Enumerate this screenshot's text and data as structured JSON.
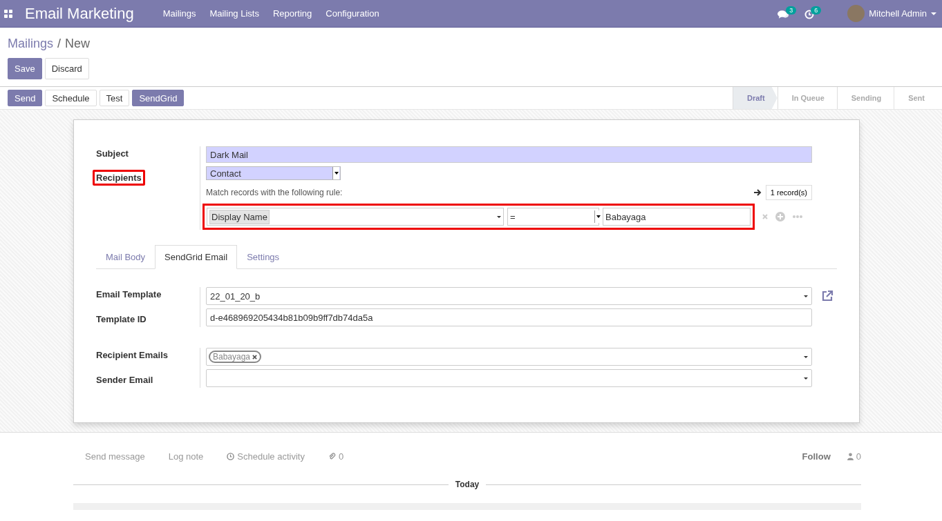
{
  "navbar": {
    "app_title": "Email Marketing",
    "menu": [
      "Mailings",
      "Mailing Lists",
      "Reporting",
      "Configuration"
    ],
    "messages_count": "3",
    "activities_count": "6",
    "user": "Mitchell Admin"
  },
  "breadcrumb": {
    "parent": "Mailings",
    "separator": "/",
    "current": "New"
  },
  "form_buttons": [
    {
      "label": "Save",
      "primary": true
    },
    {
      "label": "Discard",
      "primary": false
    }
  ],
  "action_buttons": [
    {
      "label": "Send",
      "primary": true
    },
    {
      "label": "Schedule",
      "primary": false
    },
    {
      "label": "Test",
      "primary": false
    },
    {
      "label": "SendGrid",
      "primary": true
    }
  ],
  "stages": [
    {
      "label": "Draft",
      "selected": true
    },
    {
      "label": "In Queue",
      "selected": false
    },
    {
      "label": "Sending",
      "selected": false
    },
    {
      "label": "Sent",
      "selected": false
    }
  ],
  "subject": {
    "label": "Subject",
    "value": "Dark Mail"
  },
  "recipients": {
    "label": "Recipients",
    "highlighted": true,
    "model": "Contact",
    "rule_hint": "Match records with the following rule:",
    "record_count": "1 record(s)",
    "rule": {
      "highlighted": true,
      "field": "Display Name",
      "operator": "=",
      "value": "Babayaga"
    }
  },
  "tabs": [
    {
      "label": "Mail Body",
      "selected": false
    },
    {
      "label": "SendGrid Email",
      "selected": true
    },
    {
      "label": "Settings",
      "selected": false
    }
  ],
  "template_fields": [
    {
      "label": "Email Template",
      "value": "22_01_20_b",
      "kind": "select"
    },
    {
      "label": "Template ID",
      "value": "d-e468969205434b81b09b9ff7db74da5a",
      "kind": "text"
    }
  ],
  "email_fields": [
    {
      "label": "Recipient Emails",
      "tags": [
        "Babayaga"
      ],
      "kind": "tags"
    },
    {
      "label": "Sender Email",
      "kind": "tags"
    }
  ],
  "chatter": {
    "actions": [
      "Send message",
      "Log note",
      "Schedule activity"
    ],
    "attachments": "0",
    "follow": "Follow",
    "followers": "0",
    "date_separator": "Today"
  }
}
